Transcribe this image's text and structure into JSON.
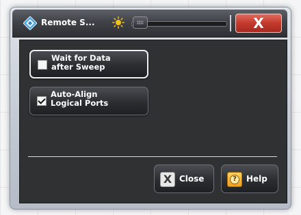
{
  "window": {
    "title": "Remote S...",
    "close_glyph": "X",
    "app_icon": "diamond-app-icon",
    "brightness_icon": "sun-icon"
  },
  "buttons": {
    "wait_for_data": {
      "line1": "Wait for Data",
      "line2": "after Sweep",
      "checked": false
    },
    "auto_align": {
      "line1": "Auto-Align",
      "line2": "Logical Ports",
      "checked": true
    }
  },
  "footer": {
    "close_label": "Close",
    "close_icon_glyph": "X",
    "help_label": "Help",
    "help_icon_glyph": "?"
  },
  "colors": {
    "title_close_red": "#c33a2d",
    "help_icon_orange": "#f0a020",
    "panel_bg": "#2f3133"
  }
}
